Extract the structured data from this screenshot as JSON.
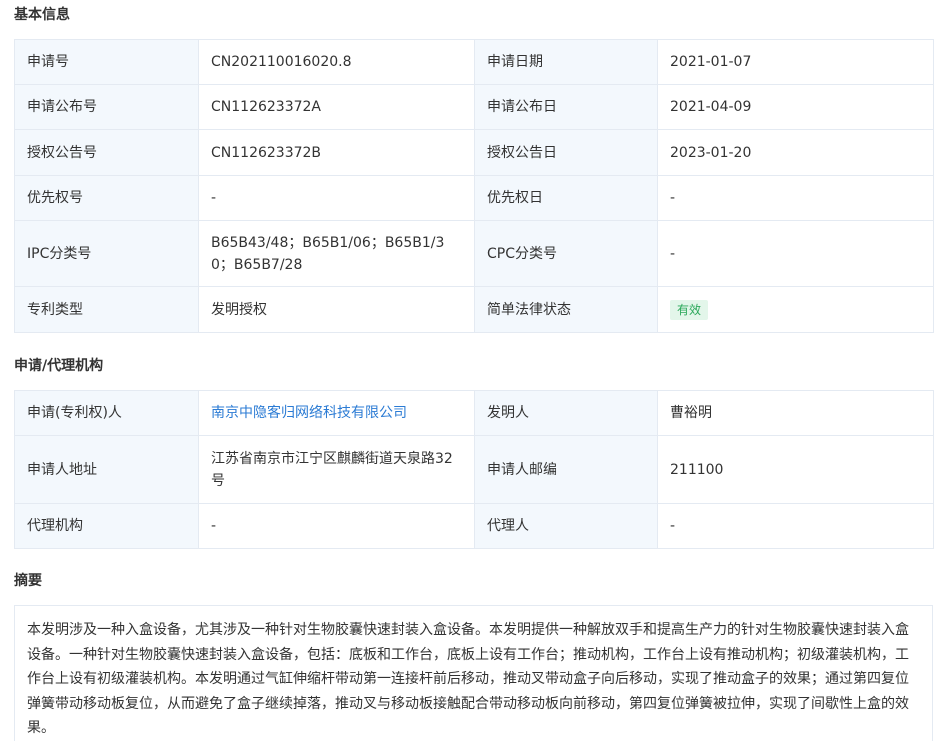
{
  "basic_info": {
    "title": "基本信息",
    "rows": [
      {
        "l1": "申请号",
        "v1": "CN202110016020.8",
        "l2": "申请日期",
        "v2": "2021-01-07"
      },
      {
        "l1": "申请公布号",
        "v1": "CN112623372A",
        "l2": "申请公布日",
        "v2": "2021-04-09"
      },
      {
        "l1": "授权公告号",
        "v1": "CN112623372B",
        "l2": "授权公告日",
        "v2": "2023-01-20"
      },
      {
        "l1": "优先权号",
        "v1": "-",
        "l2": "优先权日",
        "v2": "-"
      },
      {
        "l1": "IPC分类号",
        "v1": "B65B43/48；B65B1/06；B65B1/30；B65B7/28",
        "l2": "CPC分类号",
        "v2": "-"
      },
      {
        "l1": "专利类型",
        "v1": "发明授权",
        "l2": "简单法律状态",
        "v2": "有效"
      }
    ]
  },
  "agency": {
    "title": "申请/代理机构",
    "rows": [
      {
        "l1": "申请(专利权)人",
        "v1": "南京中隐客归网络科技有限公司",
        "l2": "发明人",
        "v2": "曹裕明"
      },
      {
        "l1": "申请人地址",
        "v1": "江苏省南京市江宁区麒麟街道天泉路32号",
        "l2": "申请人邮编",
        "v2": "211100"
      },
      {
        "l1": "代理机构",
        "v1": "-",
        "l2": "代理人",
        "v2": "-"
      }
    ]
  },
  "abstract": {
    "title": "摘要",
    "text": "本发明涉及一种入盒设备，尤其涉及一种针对生物胶囊快速封装入盒设备。本发明提供一种解放双手和提高生产力的针对生物胶囊快速封装入盒设备。一种针对生物胶囊快速封装入盒设备，包括：底板和工作台，底板上设有工作台；推动机构，工作台上设有推动机构；初级灌装机构，工作台上设有初级灌装机构。本发明通过气缸伸缩杆带动第一连接杆前后移动，推动叉带动盒子向后移动，实现了推动盒子的效果；通过第四复位弹簧带动移动板复位，从而避免了盒子继续掉落，推动叉与移动板接触配合带动移动板向前移动，第四复位弹簧被拉伸，实现了间歇性上盒的效果。"
  },
  "colors": {
    "label_bg": "#f3f8fd",
    "border": "#e4eaf2",
    "link": "#2b7bd4",
    "badge_bg": "#e3f6ea",
    "badge_text": "#2ba85a"
  }
}
